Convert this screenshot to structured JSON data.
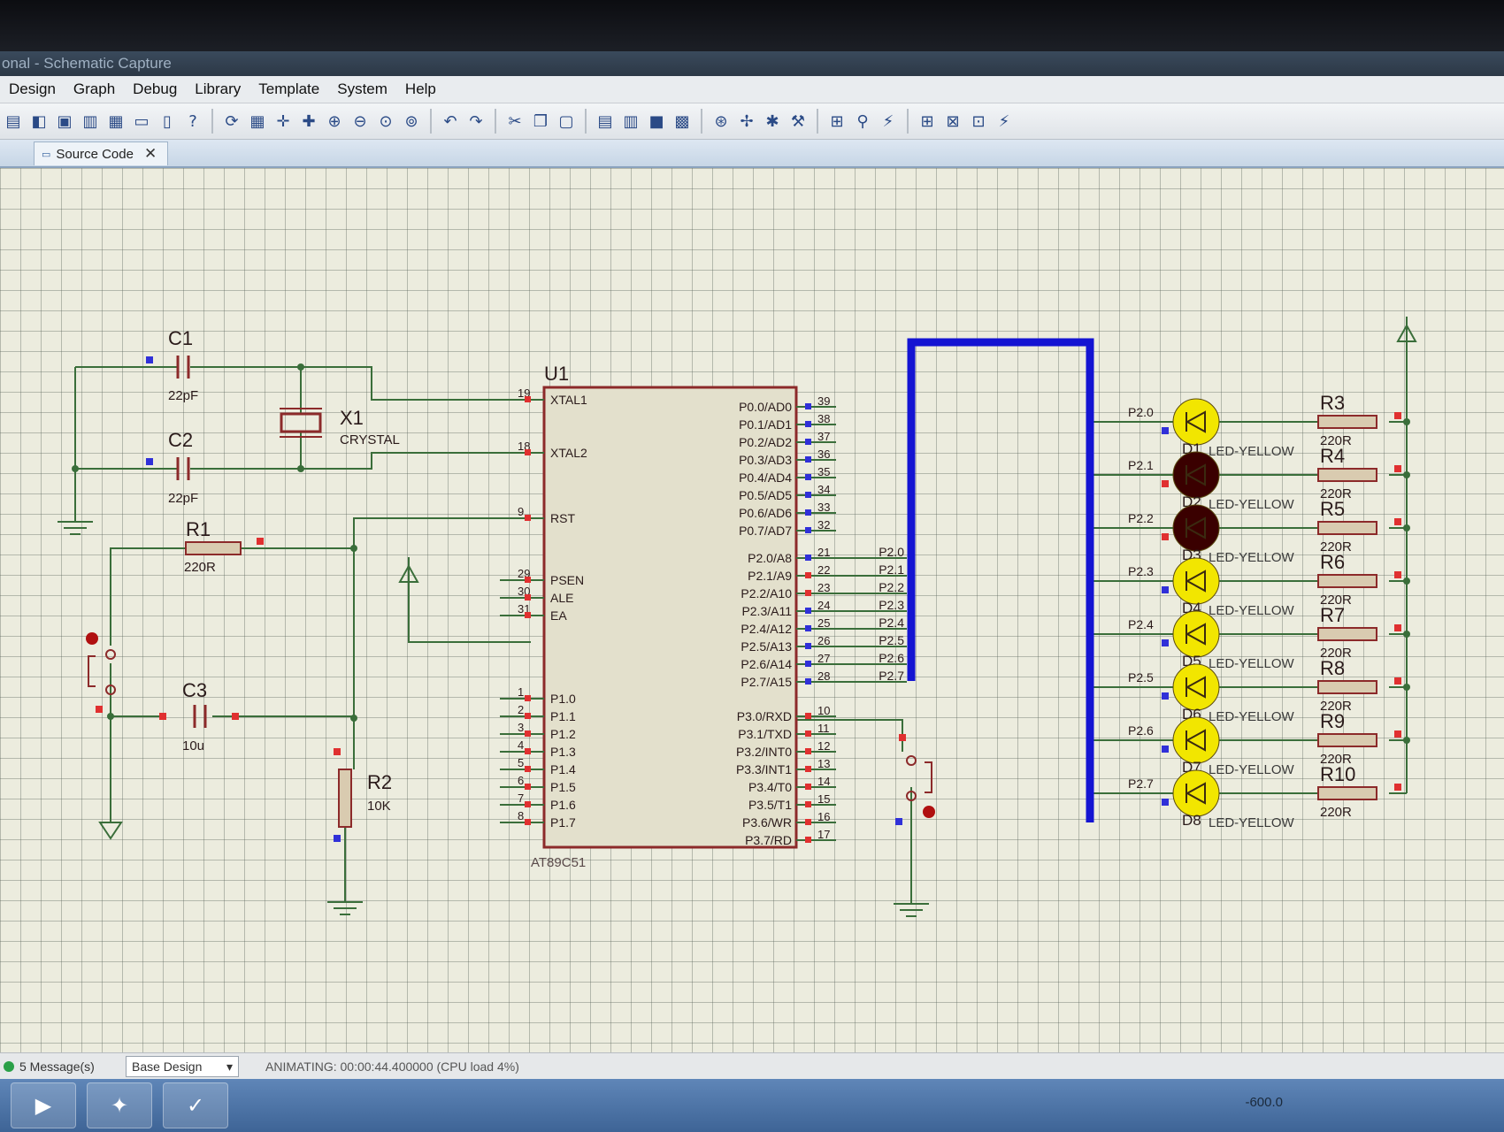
{
  "window": {
    "title": "onal - Schematic Capture"
  },
  "menu": [
    "Design",
    "Graph",
    "Debug",
    "Library",
    "Template",
    "System",
    "Help"
  ],
  "toolbar": {
    "help_glyph": "?"
  },
  "tabs": [
    {
      "label": "Source Code",
      "close": "✕"
    }
  ],
  "colors": {
    "wire": "#3a6e3a",
    "part": "#8c2a2a",
    "bus": "#1414d2",
    "led_on": "#f2e600",
    "led_off": "#3a0000",
    "text": "#2a1a1a"
  },
  "schematic": {
    "caps": [
      {
        "ref": "C1",
        "value": "22pF"
      },
      {
        "ref": "C2",
        "value": "22pF"
      },
      {
        "ref": "C3",
        "value": "10u"
      }
    ],
    "crystal": {
      "ref": "X1",
      "value": "CRYSTAL"
    },
    "r1": {
      "ref": "R1",
      "value": "220R"
    },
    "r2": {
      "ref": "R2",
      "value": "10K"
    },
    "mcu": {
      "ref": "U1",
      "part": "AT89C51",
      "left_pins": [
        {
          "num": "19",
          "name": "XTAL1"
        },
        {
          "num": "18",
          "name": "XTAL2"
        },
        {
          "num": "9",
          "name": "RST"
        },
        {
          "num": "29",
          "name": "PSEN"
        },
        {
          "num": "30",
          "name": "ALE"
        },
        {
          "num": "31",
          "name": "EA"
        },
        {
          "num": "1",
          "name": "P1.0"
        },
        {
          "num": "2",
          "name": "P1.1"
        },
        {
          "num": "3",
          "name": "P1.2"
        },
        {
          "num": "4",
          "name": "P1.3"
        },
        {
          "num": "5",
          "name": "P1.4"
        },
        {
          "num": "6",
          "name": "P1.5"
        },
        {
          "num": "7",
          "name": "P1.6"
        },
        {
          "num": "8",
          "name": "P1.7"
        }
      ],
      "right_pins": [
        {
          "num": "39",
          "name": "P0.0/AD0"
        },
        {
          "num": "38",
          "name": "P0.1/AD1"
        },
        {
          "num": "37",
          "name": "P0.2/AD2"
        },
        {
          "num": "36",
          "name": "P0.3/AD3"
        },
        {
          "num": "35",
          "name": "P0.4/AD4"
        },
        {
          "num": "34",
          "name": "P0.5/AD5"
        },
        {
          "num": "33",
          "name": "P0.6/AD6"
        },
        {
          "num": "32",
          "name": "P0.7/AD7"
        },
        {
          "num": "21",
          "name": "P2.0/A8",
          "net": "P2.0"
        },
        {
          "num": "22",
          "name": "P2.1/A9",
          "net": "P2.1"
        },
        {
          "num": "23",
          "name": "P2.2/A10",
          "net": "P2.2"
        },
        {
          "num": "24",
          "name": "P2.3/A11",
          "net": "P2.3"
        },
        {
          "num": "25",
          "name": "P2.4/A12",
          "net": "P2.4"
        },
        {
          "num": "26",
          "name": "P2.5/A13",
          "net": "P2.5"
        },
        {
          "num": "27",
          "name": "P2.6/A14",
          "net": "P2.6"
        },
        {
          "num": "28",
          "name": "P2.7/A15",
          "net": "P2.7"
        },
        {
          "num": "10",
          "name": "P3.0/RXD"
        },
        {
          "num": "11",
          "name": "P3.1/TXD"
        },
        {
          "num": "12",
          "name": "P3.2/INT0"
        },
        {
          "num": "13",
          "name": "P3.3/INT1"
        },
        {
          "num": "14",
          "name": "P3.4/T0"
        },
        {
          "num": "15",
          "name": "P3.5/T1"
        },
        {
          "num": "16",
          "name": "P3.6/WR"
        },
        {
          "num": "17",
          "name": "P3.7/RD"
        }
      ]
    },
    "leds": [
      {
        "net": "P2.0",
        "ref": "D1",
        "part": "LED-YELLOW",
        "resistor": "R3",
        "value": "220R",
        "lit": true
      },
      {
        "net": "P2.1",
        "ref": "D2",
        "part": "LED-YELLOW",
        "resistor": "R4",
        "value": "220R",
        "lit": false
      },
      {
        "net": "P2.2",
        "ref": "D3",
        "part": "LED-YELLOW",
        "resistor": "R5",
        "value": "220R",
        "lit": false
      },
      {
        "net": "P2.3",
        "ref": "D4",
        "part": "LED-YELLOW",
        "resistor": "R6",
        "value": "220R",
        "lit": true
      },
      {
        "net": "P2.4",
        "ref": "D5",
        "part": "LED-YELLOW",
        "resistor": "R7",
        "value": "220R",
        "lit": true
      },
      {
        "net": "P2.5",
        "ref": "D6",
        "part": "LED-YELLOW",
        "resistor": "R8",
        "value": "220R",
        "lit": true
      },
      {
        "net": "P2.6",
        "ref": "D7",
        "part": "LED-YELLOW",
        "resistor": "R9",
        "value": "220R",
        "lit": true
      },
      {
        "net": "P2.7",
        "ref": "D8",
        "part": "LED-YELLOW",
        "resistor": "R10",
        "value": "220R",
        "lit": true
      }
    ]
  },
  "status": {
    "messages": "5 Message(s)",
    "design": "Base Design",
    "animating": "ANIMATING: 00:00:44.400000 (CPU load 4%)",
    "coord": "-600.0"
  },
  "taskbar": [
    "media-player-icon",
    "network-icon",
    "proteus-isis-icon"
  ]
}
